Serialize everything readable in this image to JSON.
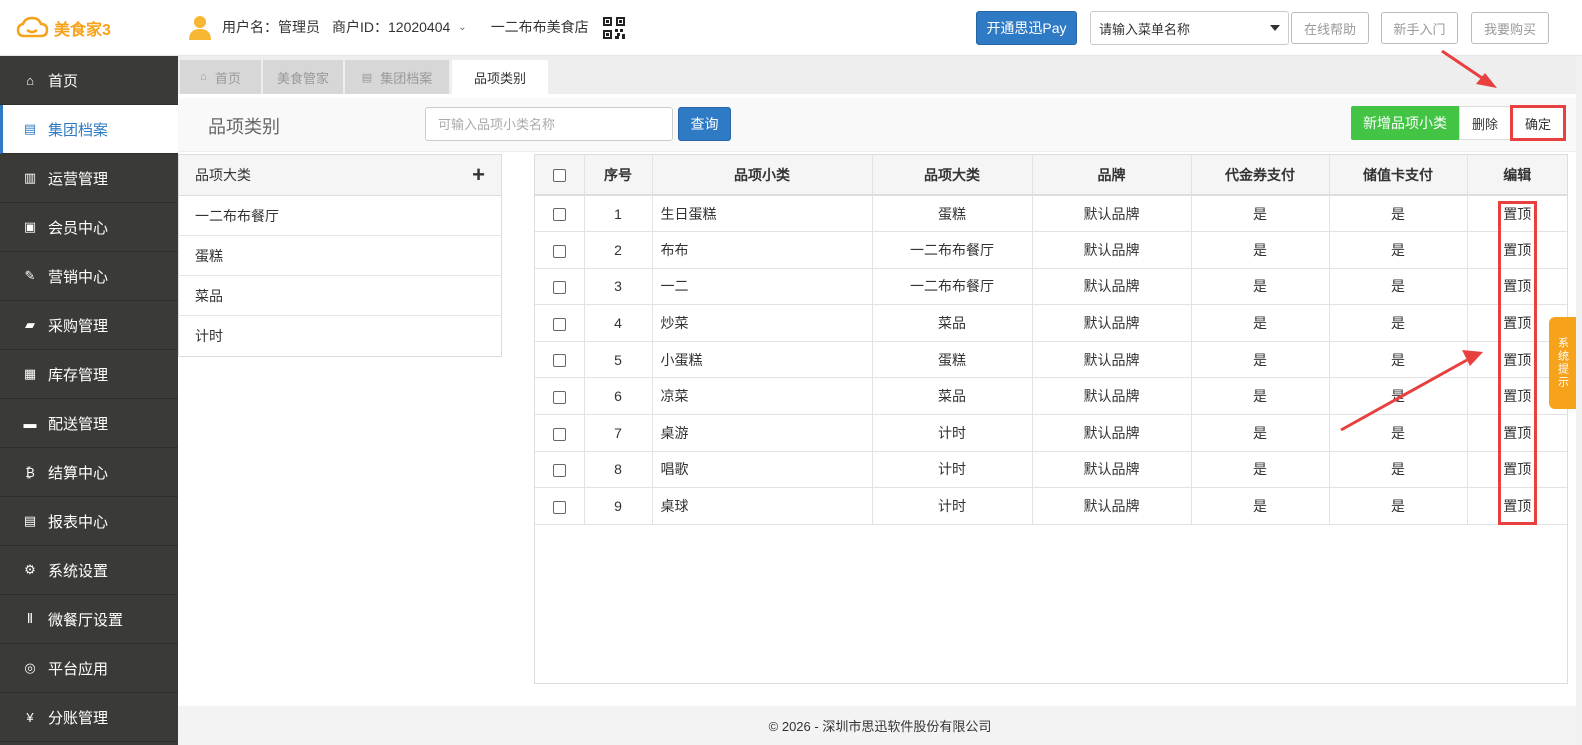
{
  "header": {
    "logo_text": "美食家3",
    "user_label": "用户名：管理员",
    "merchant_label": "商户ID：12020404",
    "store_name": "一二布布美食店",
    "pay_button": "开通思迅Pay",
    "menu_search_placeholder": "请输入菜单名称",
    "help_button": "在线帮助",
    "newbie_button": "新手入门",
    "buy_button": "我要购买"
  },
  "sidebar": {
    "items": [
      {
        "label": "首页",
        "icon": "home-icon"
      },
      {
        "label": "集团档案",
        "icon": "document-icon"
      },
      {
        "label": "运营管理",
        "icon": "bar-chart-icon"
      },
      {
        "label": "会员中心",
        "icon": "id-card-icon"
      },
      {
        "label": "营销中心",
        "icon": "edit-icon"
      },
      {
        "label": "采购管理",
        "icon": "book-icon"
      },
      {
        "label": "库存管理",
        "icon": "building-icon"
      },
      {
        "label": "配送管理",
        "icon": "truck-icon"
      },
      {
        "label": "结算中心",
        "icon": "bitcoin-icon"
      },
      {
        "label": "报表中心",
        "icon": "report-icon"
      },
      {
        "label": "系统设置",
        "icon": "gears-icon"
      },
      {
        "label": "微餐厅设置",
        "icon": "cutlery-icon"
      },
      {
        "label": "平台应用",
        "icon": "compass-icon"
      },
      {
        "label": "分账管理",
        "icon": "yen-icon"
      }
    ]
  },
  "tabs": [
    {
      "label": "首页",
      "icon": "home-icon"
    },
    {
      "label": "美食管家",
      "icon": ""
    },
    {
      "label": "集团档案",
      "icon": "document-icon"
    },
    {
      "label": "品项类别",
      "icon": ""
    }
  ],
  "toolbar": {
    "title": "品项类别",
    "search_placeholder": "可输入品项小类名称",
    "query_button": "查询",
    "add_button": "新增品项小类",
    "delete_button": "删除",
    "confirm_button": "确定"
  },
  "category_panel": {
    "header": "品项大类",
    "items": [
      "一二布布餐厅",
      "蛋糕",
      "菜品",
      "计时"
    ]
  },
  "table": {
    "columns": [
      "序号",
      "品项小类",
      "品项大类",
      "品牌",
      "代金券支付",
      "储值卡支付",
      "编辑"
    ],
    "rows": [
      {
        "no": "1",
        "sub": "生日蛋糕",
        "main": "蛋糕",
        "brand": "默认品牌",
        "voucher": "是",
        "card": "是",
        "edit": "置顶"
      },
      {
        "no": "2",
        "sub": "布布",
        "main": "一二布布餐厅",
        "brand": "默认品牌",
        "voucher": "是",
        "card": "是",
        "edit": "置顶"
      },
      {
        "no": "3",
        "sub": "一二",
        "main": "一二布布餐厅",
        "brand": "默认品牌",
        "voucher": "是",
        "card": "是",
        "edit": "置顶"
      },
      {
        "no": "4",
        "sub": "炒菜",
        "main": "菜品",
        "brand": "默认品牌",
        "voucher": "是",
        "card": "是",
        "edit": "置顶"
      },
      {
        "no": "5",
        "sub": "小蛋糕",
        "main": "蛋糕",
        "brand": "默认品牌",
        "voucher": "是",
        "card": "是",
        "edit": "置顶"
      },
      {
        "no": "6",
        "sub": "凉菜",
        "main": "菜品",
        "brand": "默认品牌",
        "voucher": "是",
        "card": "是",
        "edit": "置顶"
      },
      {
        "no": "7",
        "sub": "桌游",
        "main": "计时",
        "brand": "默认品牌",
        "voucher": "是",
        "card": "是",
        "edit": "置顶"
      },
      {
        "no": "8",
        "sub": "唱歌",
        "main": "计时",
        "brand": "默认品牌",
        "voucher": "是",
        "card": "是",
        "edit": "置顶"
      },
      {
        "no": "9",
        "sub": "桌球",
        "main": "计时",
        "brand": "默认品牌",
        "voucher": "是",
        "card": "是",
        "edit": "置顶"
      }
    ]
  },
  "footer": {
    "text": "© 2026 - 深圳市思迅软件股份有限公司"
  },
  "system_tip": "系统提示",
  "colors": {
    "accent": "#2f7ac4",
    "green": "#44c444",
    "orange": "#f7a21b",
    "highlight": "#e8403f",
    "sidebar": "#3a3a37"
  }
}
